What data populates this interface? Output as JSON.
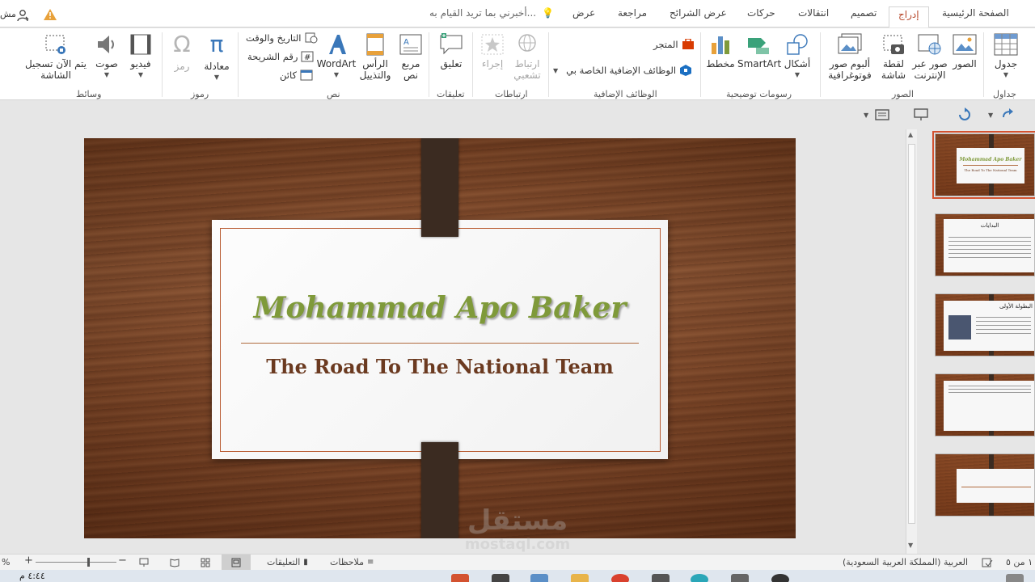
{
  "tabs": {
    "home": "الصفحة الرئيسية",
    "insert": "إدراج",
    "design": "تصميم",
    "transitions": "انتقالات",
    "animations": "حركات",
    "slideshow": "عرض الشرائح",
    "review": "مراجعة",
    "view": "عرض",
    "tell_me": "أخبرني بما تريد القيام به...",
    "account": "مش"
  },
  "ribbon": {
    "tables": {
      "table": "جدول",
      "group": "جداول"
    },
    "images": {
      "pictures": "الصور",
      "online_pictures_1": "صور عبر",
      "online_pictures_2": "الإنترنت",
      "screenshot_1": "لقطة",
      "screenshot_2": "شاشة",
      "album_1": "ألبوم صور",
      "album_2": "فوتوغرافية",
      "group": "الصور"
    },
    "illustrations": {
      "shapes": "أشكال",
      "smartart": "SmartArt",
      "chart": "مخطط",
      "group": "رسومات توضيحية"
    },
    "addins": {
      "store": "المتجر",
      "my_addins": "الوظائف الإضافية الخاصة بي",
      "group": "الوظائف الإضافية"
    },
    "links": {
      "hyperlink_1": "ارتباط",
      "hyperlink_2": "تشعبي",
      "action": "إجراء",
      "group": "ارتباطات"
    },
    "comments": {
      "comment": "تعليق",
      "group": "تعليقات"
    },
    "text": {
      "textbox_1": "مربع",
      "textbox_2": "نص",
      "header_1": "الرأس",
      "header_2": "والتذييل",
      "wordart": "WordArt",
      "datetime": "التاريخ والوقت",
      "slide_number": "رقم الشريحة",
      "object": "كائن",
      "group": "نص"
    },
    "symbols": {
      "equation": "معادلة",
      "symbol": "رمز",
      "group": "رموز"
    },
    "media": {
      "video": "فيديو",
      "audio": "صوت",
      "screen_rec_1": "يتم الآن تسجيل",
      "screen_rec_2": "الشاشة",
      "group": "وسائط"
    }
  },
  "slide": {
    "title": "Mohammad Apo Baker",
    "subtitle": "The Road To The National Team"
  },
  "thumbnails": [
    {
      "index": 1,
      "title": "Mohammad Apo Baker",
      "subtitle": "The Road To The National Team",
      "selected": true
    },
    {
      "index": 2,
      "title": "البدايات",
      "selected": false
    },
    {
      "index": 3,
      "title": "البطولة الأولى",
      "selected": false
    },
    {
      "index": 4,
      "selected": false
    },
    {
      "index": 5,
      "selected": false
    }
  ],
  "statusbar": {
    "slide_counter": "١ من ٥",
    "language": "العربية (المملكة العربية السعودية)",
    "notes": "ملاحظات",
    "comments": "التعليقات",
    "zoom_percent": "%"
  },
  "taskbar": {
    "time": "٤:٤٤ م"
  },
  "watermark": {
    "arabic": "مستقل",
    "latin": "mostaql.com"
  },
  "colors": {
    "accent": "#b7472a",
    "title_green": "#7f9a3a",
    "subtitle_brown": "#6b3a20"
  }
}
